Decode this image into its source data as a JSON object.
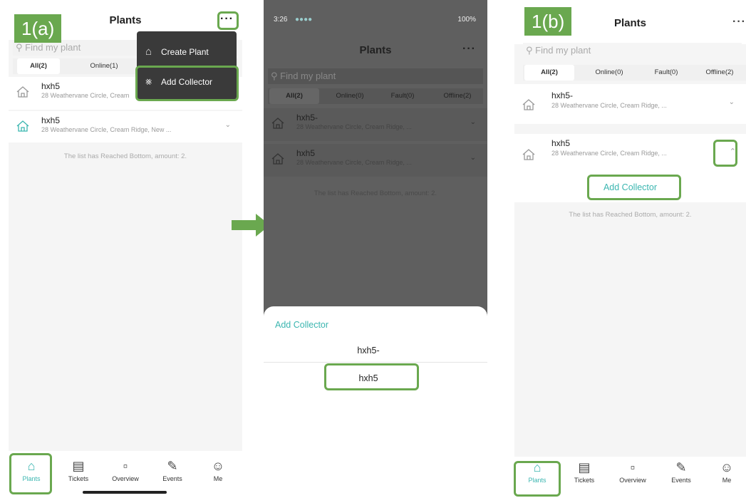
{
  "labels": {
    "a": "1(a)",
    "b": "1(b)"
  },
  "colors": {
    "accent": "#3bb6b0",
    "highlight": "#6aa84f",
    "arrow": "#6aa84f"
  },
  "screen_a": {
    "title": "Plants",
    "more": "···",
    "search_placeholder": "Find my plant",
    "tabs": [
      "All(2)",
      "Online(1)"
    ],
    "menu": {
      "create_plant": "Create Plant",
      "add_collector": "Add Collector"
    },
    "plants": [
      {
        "name": "hxh5",
        "address": "28 Weathervane Circle, Cream"
      },
      {
        "name": "hxh5",
        "address": "28 Weathervane Circle, Cream Ridge, New ..."
      }
    ],
    "bottom_note": "The list has Reached Bottom, amount: 2."
  },
  "screen_mid": {
    "status_time": "3:26",
    "status_right": "100%",
    "title": "Plants",
    "more": "···",
    "search_placeholder": "Find my plant",
    "tabs": [
      "All(2)",
      "Online(0)",
      "Fault(0)",
      "Offline(2)"
    ],
    "plants": [
      {
        "name": "hxh5-",
        "address": "28 Weathervane Circle, Cream Ridge, ..."
      },
      {
        "name": "hxh5",
        "address": "28 Weathervane Circle, Cream Ridge, ..."
      }
    ],
    "bottom_note": "The list has Reached Bottom, amount: 2.",
    "sheet_title": "Add Collector",
    "options": [
      "hxh5-",
      "hxh5"
    ]
  },
  "screen_b": {
    "title": "Plants",
    "more": "···",
    "search_placeholder": "Find my plant",
    "tabs": [
      "All(2)",
      "Online(0)",
      "Fault(0)",
      "Offline(2)"
    ],
    "plants": [
      {
        "name": "hxh5-",
        "address": "28 Weathervane Circle, Cream Ridge, ..."
      },
      {
        "name": "hxh5",
        "address": "28 Weathervane Circle, Cream Ridge, ..."
      }
    ],
    "add_collector": "Add Collector",
    "bottom_note": "The list has Reached Bottom, amount: 2."
  },
  "nav": [
    {
      "label": "Plants",
      "icon": "home-icon"
    },
    {
      "label": "Tickets",
      "icon": "ticket-icon"
    },
    {
      "label": "Overview",
      "icon": "chart-icon"
    },
    {
      "label": "Events",
      "icon": "wrench-icon"
    },
    {
      "label": "Me",
      "icon": "person-icon"
    }
  ]
}
